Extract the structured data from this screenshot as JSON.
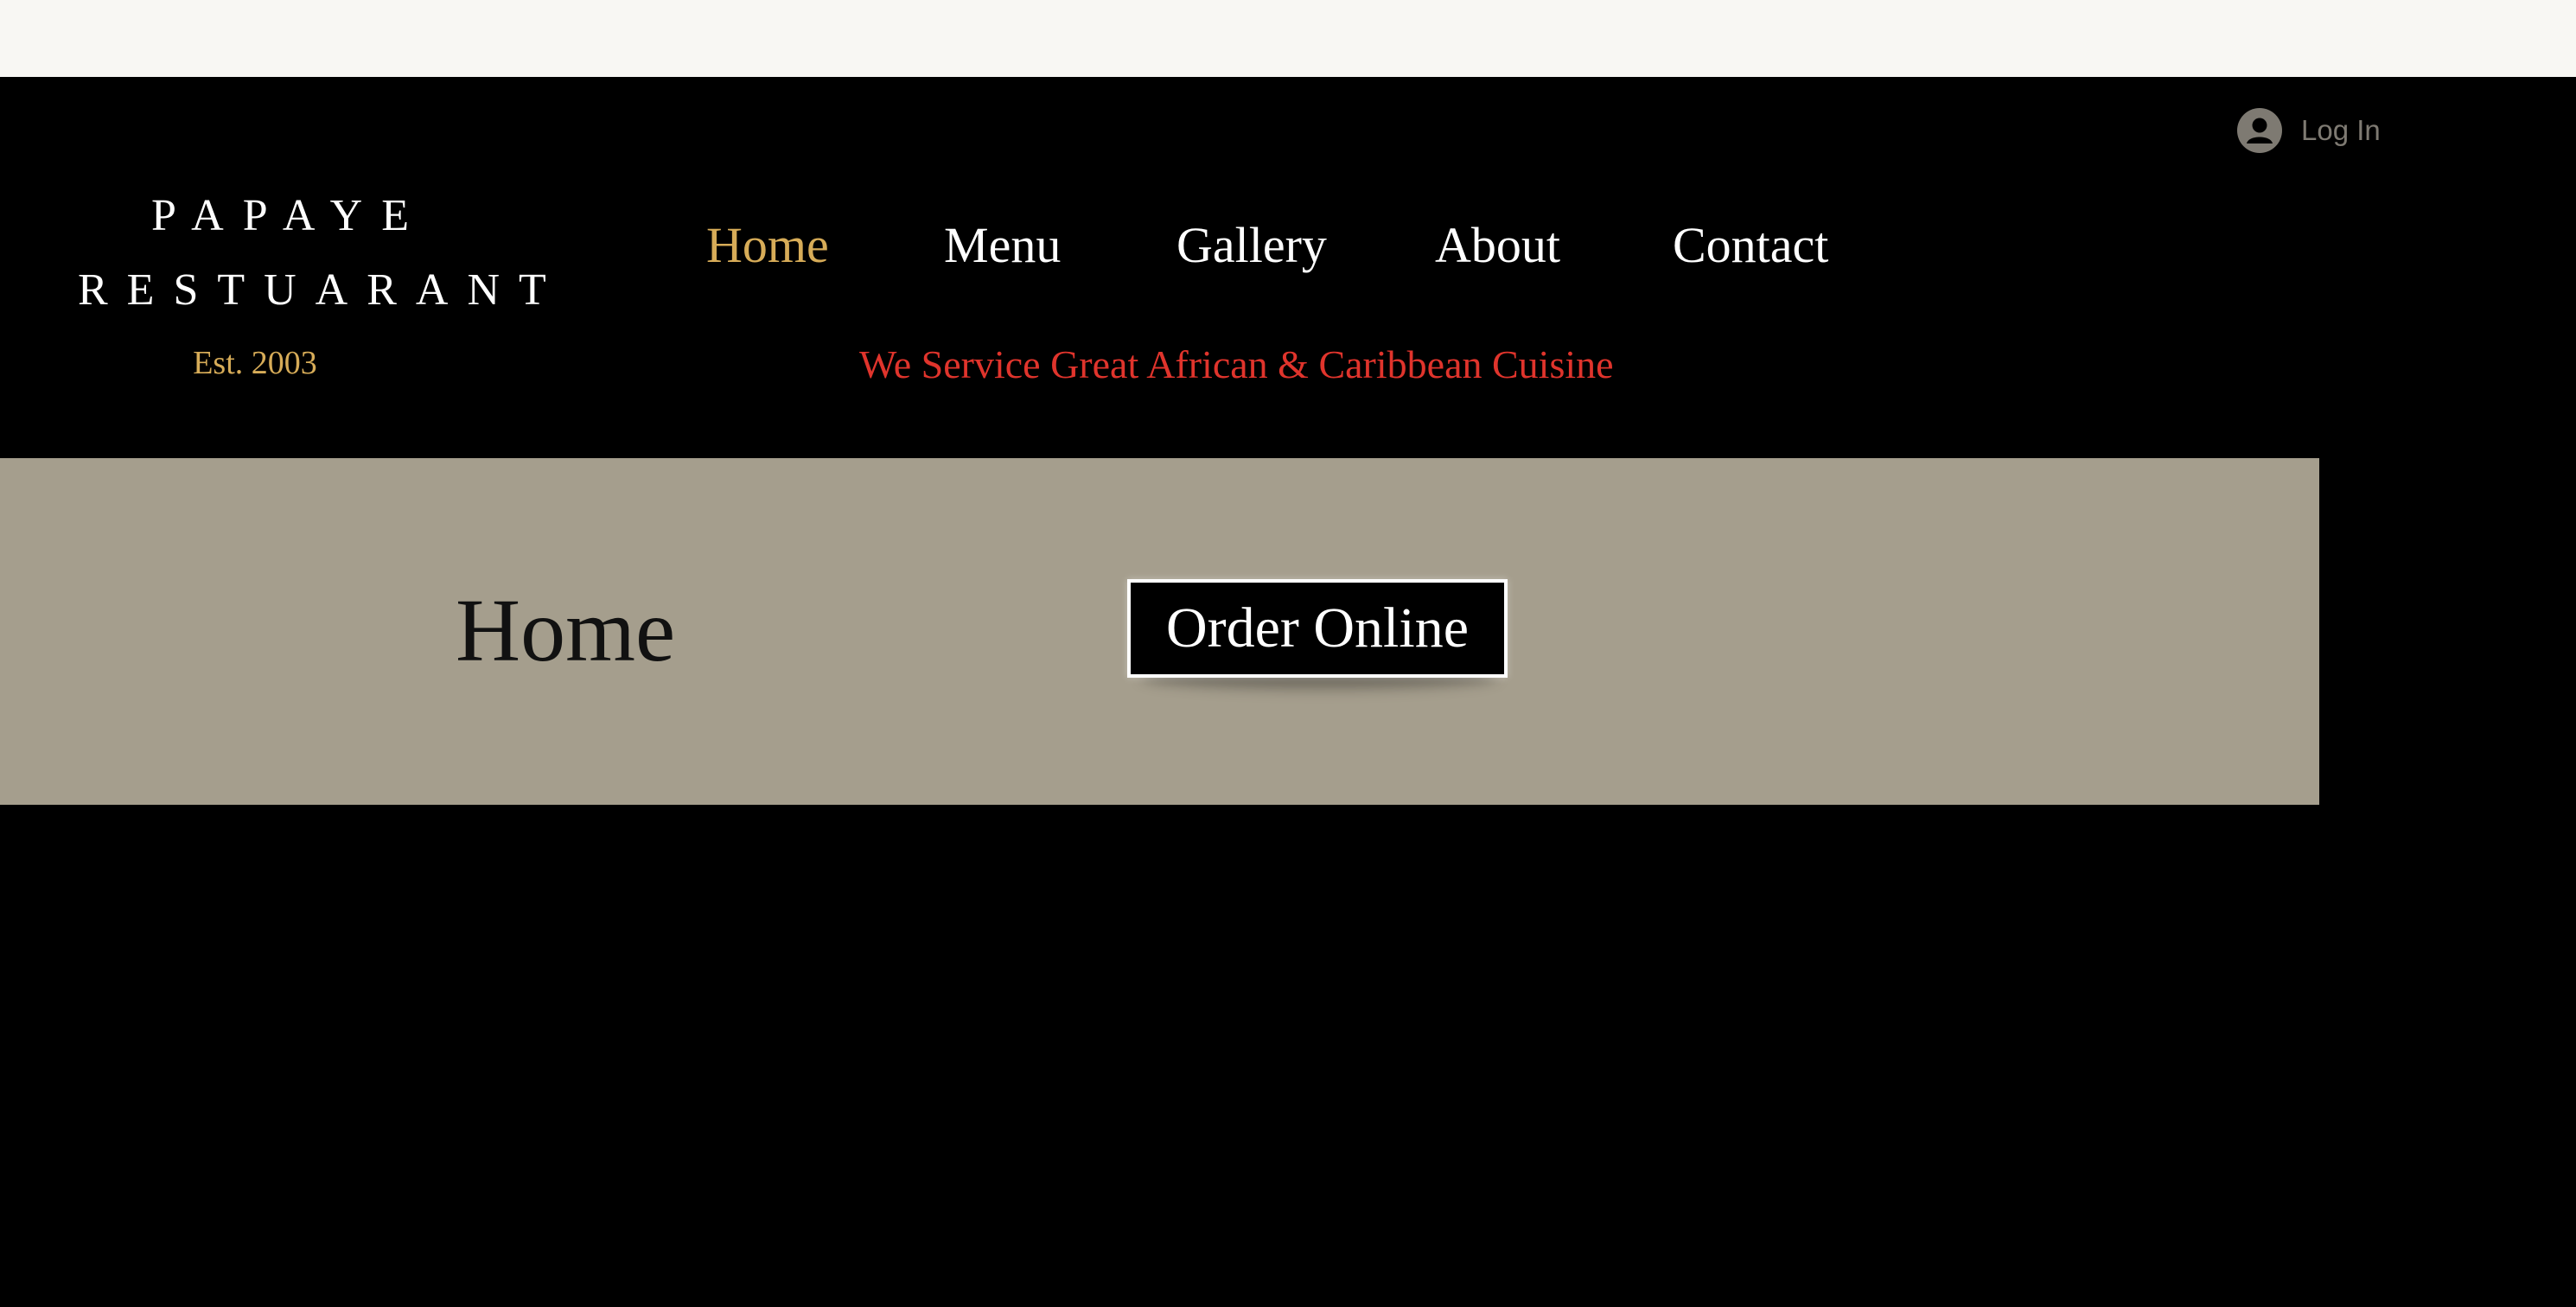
{
  "header": {
    "login_label": "Log In",
    "logo_line1": "PAPAYE",
    "logo_line2": "RESTUARANT",
    "established": "Est. 2003",
    "tagline": "We Service Great African & Caribbean Cuisine"
  },
  "nav": {
    "items": [
      {
        "label": "Home",
        "active": true
      },
      {
        "label": "Menu",
        "active": false
      },
      {
        "label": "Gallery",
        "active": false
      },
      {
        "label": "About",
        "active": false
      },
      {
        "label": "Contact",
        "active": false
      }
    ]
  },
  "banner": {
    "page_title": "Home",
    "order_button_label": "Order Online"
  },
  "colors": {
    "background": "#000000",
    "top_strip": "#f8f7f3",
    "banner": "#a59e8d",
    "accent_gold": "#d7ac58",
    "tagline_red": "#e0342c",
    "login_text": "#7e7a72"
  },
  "icons": {
    "login": "user-avatar-icon"
  }
}
